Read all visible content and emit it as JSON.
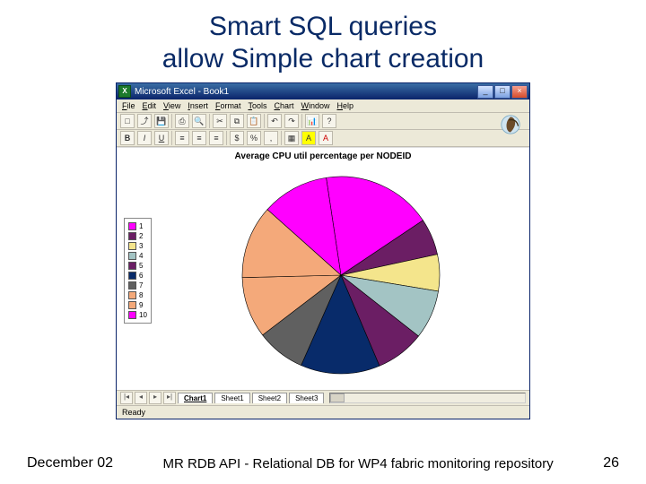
{
  "slide": {
    "title_line1": "Smart SQL queries",
    "title_line2": "allow Simple chart creation"
  },
  "excel": {
    "title": "Microsoft Excel - Book1",
    "menu": [
      "File",
      "Edit",
      "View",
      "Insert",
      "Format",
      "Tools",
      "Chart",
      "Window",
      "Help"
    ],
    "tabs": [
      "Chart1",
      "Sheet1",
      "Sheet2",
      "Sheet3"
    ],
    "active_tab": "Chart1",
    "status": "Ready"
  },
  "footer": {
    "date": "December 02",
    "middle": "MR RDB API - Relational DB for WP4 fabric monitoring repository",
    "page": "26"
  },
  "chart_data": {
    "type": "pie",
    "title": "Average CPU util percentage per NODEID",
    "series_name": "NODEID",
    "categories": [
      "1",
      "2",
      "3",
      "4",
      "5",
      "6",
      "7",
      "8",
      "9",
      "10"
    ],
    "values": [
      18,
      6,
      6,
      8,
      8,
      13,
      8,
      10,
      12,
      11
    ],
    "colors": [
      "#ff00ff",
      "#6b1e64",
      "#f4e58c",
      "#a3c4c4",
      "#6b1e64",
      "#082b6a",
      "#606060",
      "#f4a97a",
      "#f4a97a",
      "#ff00ff"
    ],
    "note": "slice values are visual estimates (percent of circle); data labels not shown in source"
  }
}
